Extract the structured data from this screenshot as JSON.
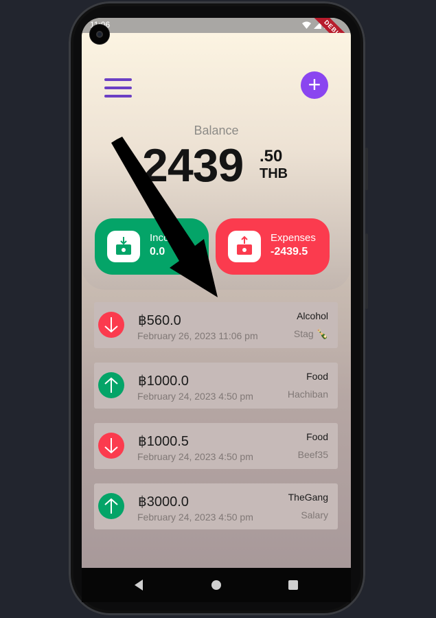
{
  "status_bar": {
    "time": "11:06",
    "debug_label": "DEBUG"
  },
  "header": {
    "balance_label": "Balance",
    "balance_integer": "2439",
    "balance_decimal": ".50",
    "currency": "THB"
  },
  "summary": {
    "income": {
      "label": "Income",
      "value": "0.0"
    },
    "expenses": {
      "label": "Expenses",
      "value": "-2439.5"
    }
  },
  "transactions": [
    {
      "type": "expense",
      "amount": "฿560.0",
      "date": "February 26, 2023 11:06 pm",
      "category": "Alcohol",
      "note": "Stag 🍾"
    },
    {
      "type": "income",
      "amount": "฿1000.0",
      "date": "February 24, 2023 4:50 pm",
      "category": "Food",
      "note": "Hachiban"
    },
    {
      "type": "expense",
      "amount": "฿1000.5",
      "date": "February 24, 2023 4:50 pm",
      "category": "Food",
      "note": "Beef35"
    },
    {
      "type": "income",
      "amount": "฿3000.0",
      "date": "February 24, 2023 4:50 pm",
      "category": "TheGang",
      "note": "Salary"
    }
  ],
  "colors": {
    "accent": "#8a45f0",
    "income": "#04a468",
    "expense": "#fb3b4e"
  },
  "icons": {
    "menu": "hamburger-icon",
    "add": "plus-icon",
    "income": "wallet-in-icon",
    "expense": "wallet-out-icon",
    "nav_back": "triangle-back-icon",
    "nav_home": "circle-home-icon",
    "nav_recents": "square-recents-icon"
  }
}
